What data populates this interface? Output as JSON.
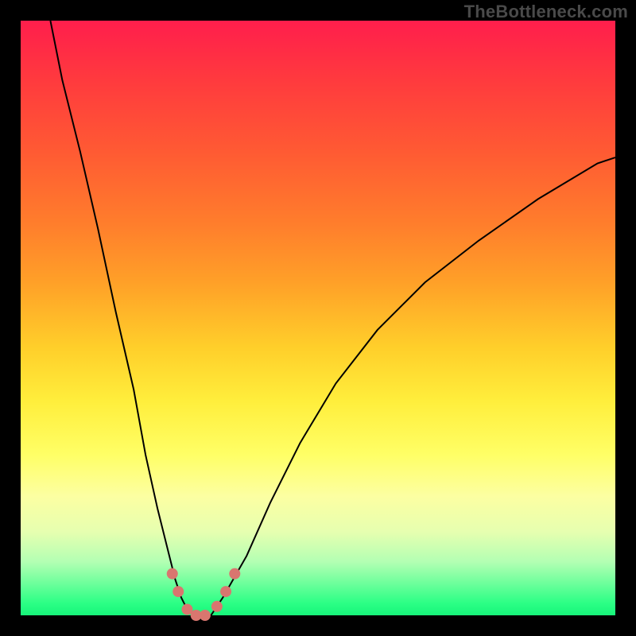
{
  "watermark": "TheBottleneck.com",
  "colors": {
    "page_bg": "#000000",
    "watermark_text": "#4a4a4a",
    "curve_stroke": "#000000",
    "marker_fill": "#d9766f",
    "gradient_top": "#ff1e4c",
    "gradient_bottom": "#17f57a"
  },
  "chart_data": {
    "type": "line",
    "title": "",
    "xlabel": "",
    "ylabel": "",
    "xlim": [
      0,
      100
    ],
    "ylim": [
      0,
      100
    ],
    "grid": false,
    "legend": false,
    "series": [
      {
        "name": "bottleneck-curve",
        "x": [
          5,
          7,
          10,
          13,
          16,
          19,
          21,
          23,
          25,
          26,
          27,
          28,
          30,
          32,
          34,
          38,
          42,
          47,
          53,
          60,
          68,
          77,
          87,
          97,
          100
        ],
        "y": [
          100,
          90,
          78,
          65,
          51,
          38,
          27,
          18,
          10,
          6,
          3,
          1,
          0,
          0,
          3,
          10,
          19,
          29,
          39,
          48,
          56,
          63,
          70,
          76,
          77
        ]
      }
    ],
    "markers": {
      "name": "highlight-points",
      "points": [
        {
          "x": 25.5,
          "y": 7
        },
        {
          "x": 26.5,
          "y": 4
        },
        {
          "x": 28,
          "y": 1
        },
        {
          "x": 29.5,
          "y": 0
        },
        {
          "x": 31,
          "y": 0
        },
        {
          "x": 33,
          "y": 1.5
        },
        {
          "x": 34.5,
          "y": 4
        },
        {
          "x": 36,
          "y": 7
        }
      ],
      "radius": 7
    },
    "note": "Axes have no tick labels in the source image; x and y are expressed in percent of the plot area (0 at left/bottom, 100 at right/top). Values are visual estimates."
  }
}
